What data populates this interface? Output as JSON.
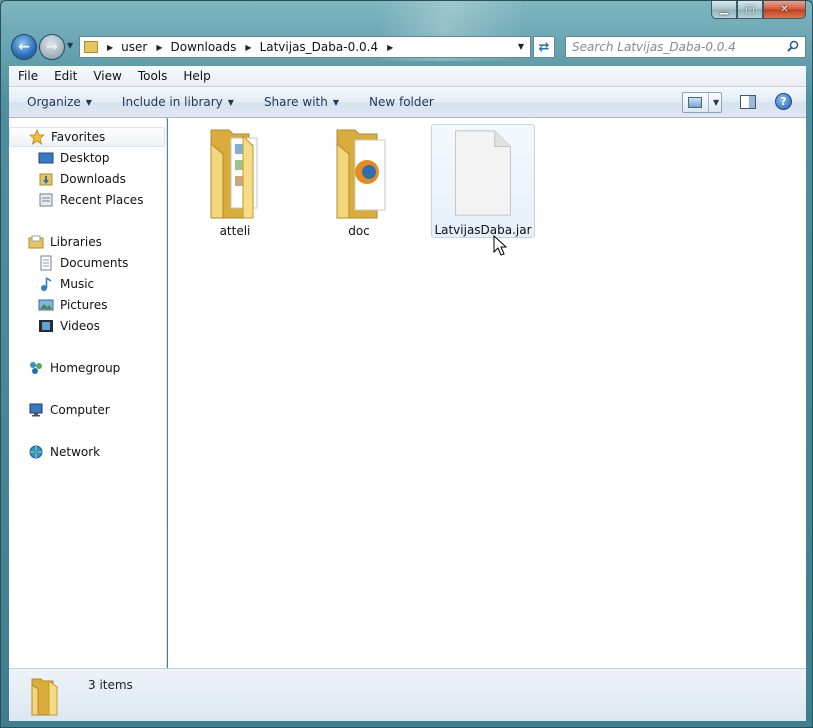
{
  "window": {
    "caption_buttons": [
      "minimize",
      "maximize",
      "close"
    ]
  },
  "nav": {
    "breadcrumb": [
      "user",
      "Downloads",
      "Latvijas_Daba-0.0.4"
    ]
  },
  "search": {
    "placeholder": "Search Latvijas_Daba-0.0.4"
  },
  "menu": {
    "items": [
      "File",
      "Edit",
      "View",
      "Tools",
      "Help"
    ]
  },
  "commands": {
    "organize": "Organize",
    "include_in_library": "Include in library",
    "share_with": "Share with",
    "new_folder": "New folder"
  },
  "sidebar": {
    "favorites": {
      "label": "Favorites",
      "items": [
        "Desktop",
        "Downloads",
        "Recent Places"
      ]
    },
    "libraries": {
      "label": "Libraries",
      "items": [
        "Documents",
        "Music",
        "Pictures",
        "Videos"
      ]
    },
    "homegroup": "Homegroup",
    "computer": "Computer",
    "network": "Network"
  },
  "files": [
    {
      "name": "atteli",
      "type": "folder",
      "icon": "folder-icon"
    },
    {
      "name": "doc",
      "type": "folder",
      "icon": "folder-icon"
    },
    {
      "name": "LatvijasDaba.jar",
      "type": "file",
      "icon": "blank-file-icon",
      "selected": true
    }
  ],
  "status": {
    "count_text": "3 items"
  },
  "colors": {
    "folder": "#e8c55e",
    "selection": "#e6f0fa",
    "command_text": "#1e395b"
  }
}
